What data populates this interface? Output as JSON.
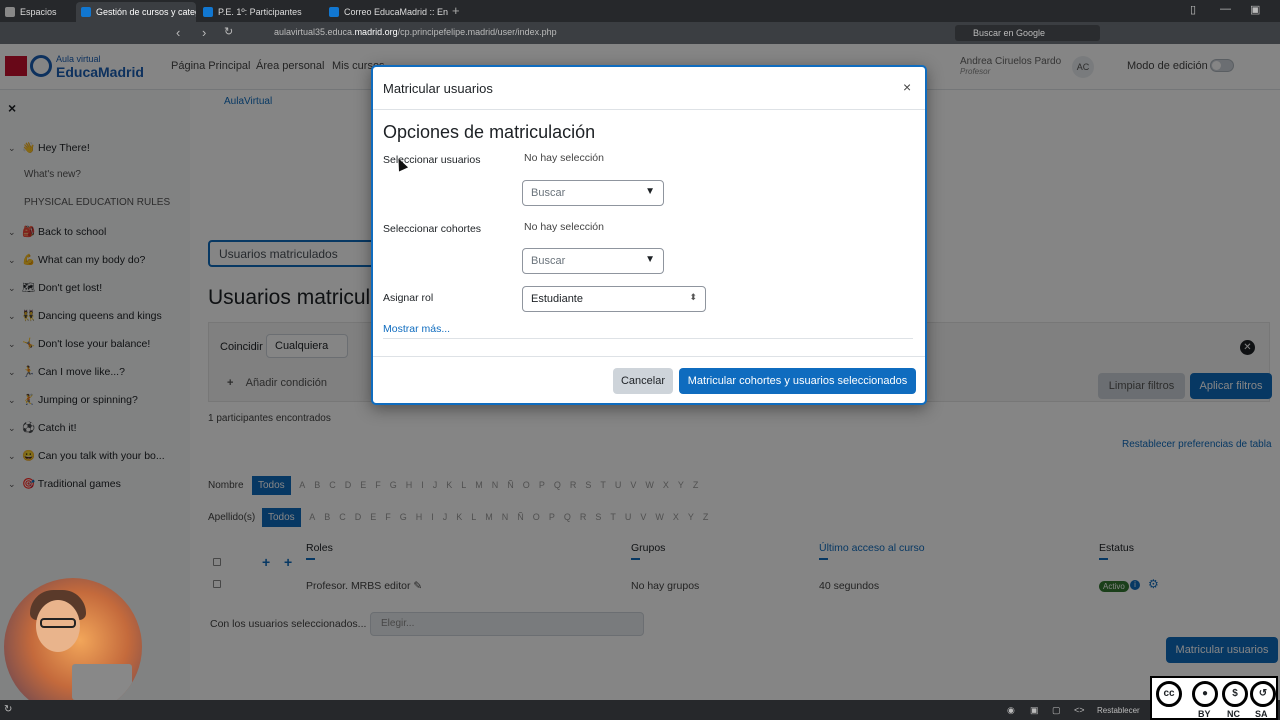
{
  "browser": {
    "tabs": [
      {
        "label": "Espacios"
      },
      {
        "label": "Gestión de cursos y categorías"
      },
      {
        "label": "P.E. 1º: Participantes"
      },
      {
        "label": "Correo EducaMadrid :: Entrada"
      }
    ],
    "url_pre": "aulavirtual35.educa.",
    "url_domain": "madrid.org",
    "url_post": "/cp.principefelipe.madrid/user/index.php",
    "search_placeholder": "Buscar en Google"
  },
  "site": {
    "logo_small": "Aula virtual",
    "logo_big": "EducaMadrid",
    "nav": [
      "Página Principal",
      "Área personal",
      "Mis cursos"
    ],
    "user_name": "Andrea Ciruelos Pardo",
    "user_role": "Profesor",
    "user_initials": "AC",
    "edit_mode": "Modo de edición"
  },
  "sidebar": {
    "close": "×",
    "items": [
      {
        "label": "👋 Hey There!"
      },
      {
        "label": "What's new?"
      },
      {
        "label": "PHYSICAL EDUCATION RULES"
      },
      {
        "label": "🎒 Back to school"
      },
      {
        "label": "💪 What can my body do?"
      },
      {
        "label": "🗺 Don't get lost!"
      },
      {
        "label": "👯 Dancing queens and kings"
      },
      {
        "label": "🤸 Don't lose your balance!"
      },
      {
        "label": "🏃 Can I move like...?"
      },
      {
        "label": "🤾 Jumping or spinning?"
      },
      {
        "label": "⚽ Catch it!"
      },
      {
        "label": "😀 Can you talk with your bo..."
      },
      {
        "label": "🎯 Traditional games"
      }
    ]
  },
  "main": {
    "breadcrumb": "AulaVirtual",
    "enrol_select": "Usuarios matriculados",
    "heading": "Usuarios matriculados",
    "filter": {
      "match_label": "Coincidir",
      "match_value": "Cualquiera",
      "add_condition": "Añadir condición",
      "clear": "Limpiar filtros",
      "apply": "Aplicar filtros"
    },
    "count": "1 participantes encontrados",
    "reset": "Restablecer preferencias de tabla",
    "name_label": "Nombre",
    "surname_label": "Apellido(s)",
    "all": "Todos",
    "letters": [
      "A",
      "B",
      "C",
      "D",
      "E",
      "F",
      "G",
      "H",
      "I",
      "J",
      "K",
      "L",
      "M",
      "N",
      "Ñ",
      "O",
      "P",
      "Q",
      "R",
      "S",
      "T",
      "U",
      "V",
      "W",
      "X",
      "Y",
      "Z"
    ],
    "table": {
      "headers": {
        "roles": "Roles",
        "groups": "Grupos",
        "last_access": "Último acceso al curso",
        "status": "Estatus"
      },
      "row": {
        "role": "Profesor. MRBS editor",
        "groups": "No hay grupos",
        "last_access": "40 segundos",
        "status": "Activo"
      }
    },
    "bulk_label": "Con los usuarios seleccionados...",
    "bulk_placeholder": "Elegir...",
    "enrol_button": "Matricular usuarios"
  },
  "modal": {
    "title": "Matricular usuarios",
    "close": "×",
    "heading": "Opciones de matriculación",
    "select_users_label": "Seleccionar usuarios",
    "select_users_none": "No hay selección",
    "select_users_search": "Buscar",
    "select_cohorts_label": "Seleccionar cohortes",
    "select_cohorts_none": "No hay selección",
    "select_cohorts_search": "Buscar",
    "role_label": "Asignar rol",
    "role_value": "Estudiante",
    "show_more": "Mostrar más...",
    "cancel": "Cancelar",
    "submit": "Matricular cohortes y usuarios seleccionados"
  },
  "license": {
    "by": "BY",
    "nc": "NC",
    "sa": "SA"
  },
  "statusbar": {
    "reset": "Restablecer"
  }
}
